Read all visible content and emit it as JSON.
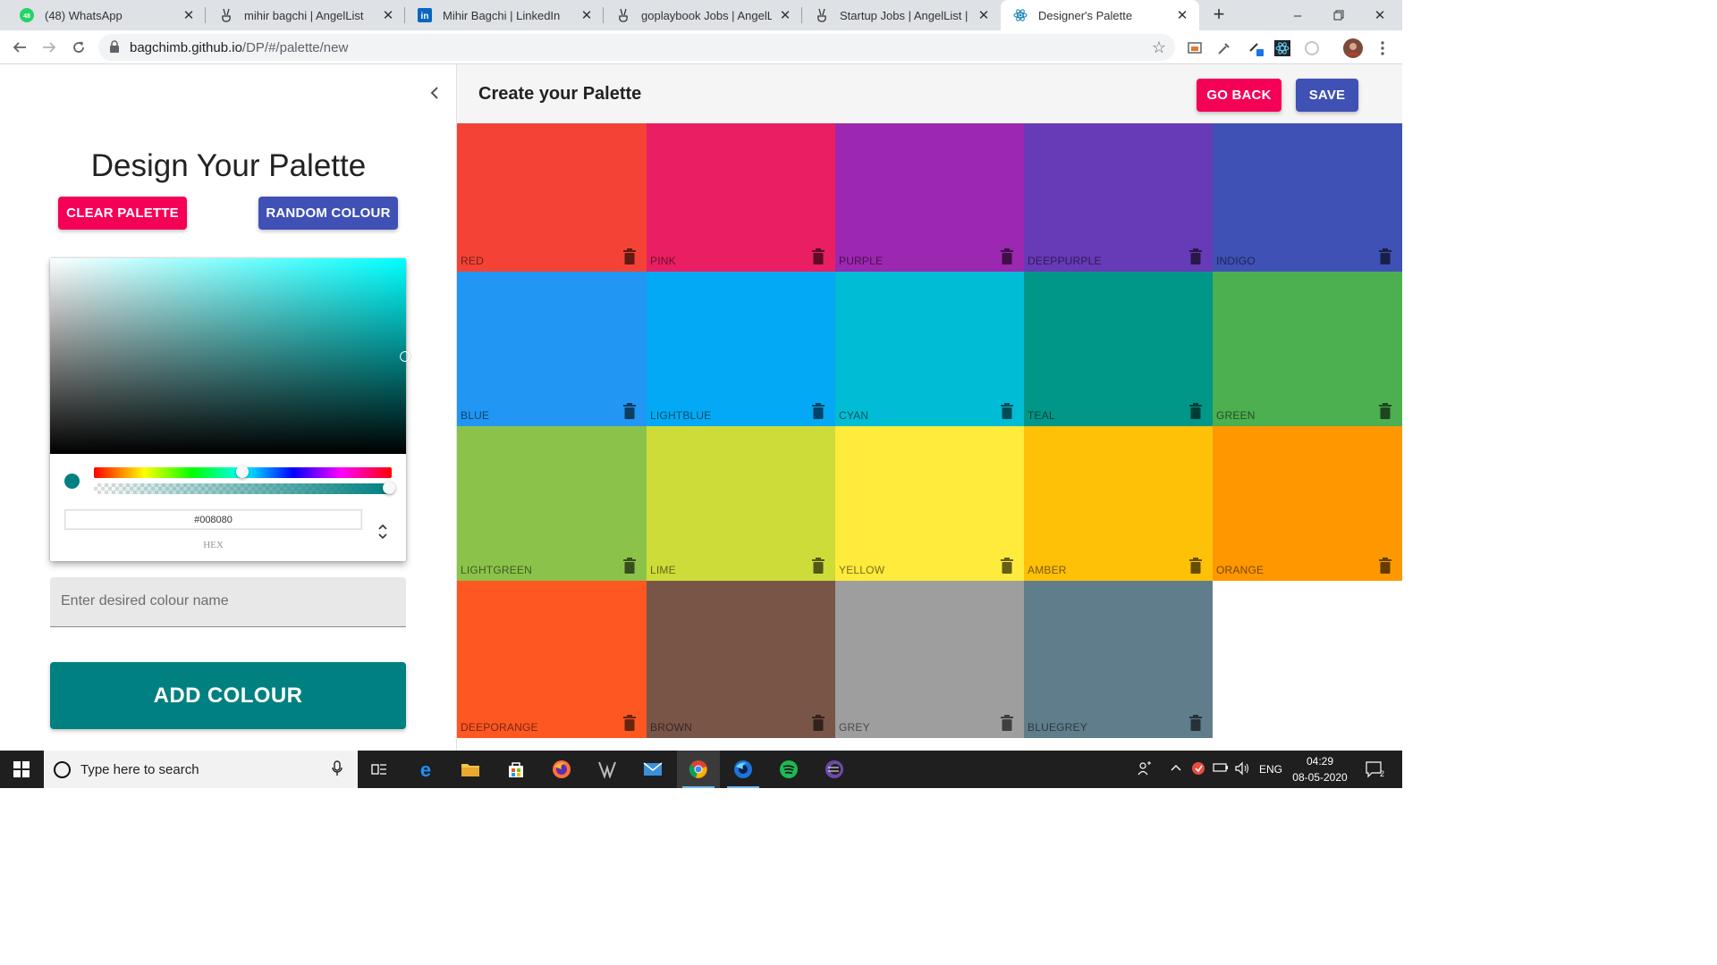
{
  "browser": {
    "tabs": [
      {
        "title": "(48) WhatsApp",
        "icon": "whatsapp-icon"
      },
      {
        "title": "mihir bagchi | AngelList",
        "icon": "angellist-icon"
      },
      {
        "title": "Mihir Bagchi | LinkedIn",
        "icon": "linkedin-icon"
      },
      {
        "title": "goplaybook Jobs | AngelList",
        "icon": "angellist-icon"
      },
      {
        "title": "Startup Jobs | AngelList | Ang",
        "icon": "angellist-icon"
      },
      {
        "title": "Designer's Palette",
        "icon": "react-icon"
      }
    ],
    "active_tab": 5,
    "whatsapp_badge": "48",
    "url_domain": "bagchimb.github.io",
    "url_path": "/DP/#/palette/new"
  },
  "drawer": {
    "title": "Design Your Palette",
    "clear_label": "CLEAR PALETTE",
    "random_label": "RANDOM COLOUR",
    "picker": {
      "hex_value": "#008080",
      "mode_label": "HEX",
      "current_color": "#008080",
      "hue_color": "#00ffff"
    },
    "name_placeholder": "Enter desired colour name",
    "add_label": "ADD COLOUR"
  },
  "appbar": {
    "title": "Create your Palette",
    "goback_label": "GO BACK",
    "save_label": "SAVE"
  },
  "palette": [
    {
      "name": "RED",
      "color": "#f44336"
    },
    {
      "name": "PINK",
      "color": "#e91e63"
    },
    {
      "name": "PURPLE",
      "color": "#9c27b0"
    },
    {
      "name": "DEEPPURPLE",
      "color": "#673ab7"
    },
    {
      "name": "INDIGO",
      "color": "#3f51b5"
    },
    {
      "name": "BLUE",
      "color": "#2196f3"
    },
    {
      "name": "LIGHTBLUE",
      "color": "#03a9f4"
    },
    {
      "name": "CYAN",
      "color": "#00bcd4"
    },
    {
      "name": "TEAL",
      "color": "#009688"
    },
    {
      "name": "GREEN",
      "color": "#4caf50"
    },
    {
      "name": "LIGHTGREEN",
      "color": "#8bc34a"
    },
    {
      "name": "LIME",
      "color": "#cddc39"
    },
    {
      "name": "YELLOW",
      "color": "#ffeb3b"
    },
    {
      "name": "AMBER",
      "color": "#ffc107"
    },
    {
      "name": "ORANGE",
      "color": "#ff9800"
    },
    {
      "name": "DEEPORANGE",
      "color": "#ff5722"
    },
    {
      "name": "BROWN",
      "color": "#795548"
    },
    {
      "name": "GREY",
      "color": "#9e9e9e"
    },
    {
      "name": "BLUEGREY",
      "color": "#607d8b"
    }
  ],
  "taskbar": {
    "search_placeholder": "Type here to search",
    "language": "ENG",
    "time": "04:29",
    "date": "08-05-2020",
    "notification_count": "2",
    "apps": [
      "task-view-icon",
      "edge-icon",
      "file-explorer-icon",
      "store-icon",
      "firefox-icon",
      "predator-icon",
      "mail-icon",
      "chrome-icon",
      "firefox-dev-icon",
      "spotify-icon",
      "eclipse-icon"
    ]
  }
}
